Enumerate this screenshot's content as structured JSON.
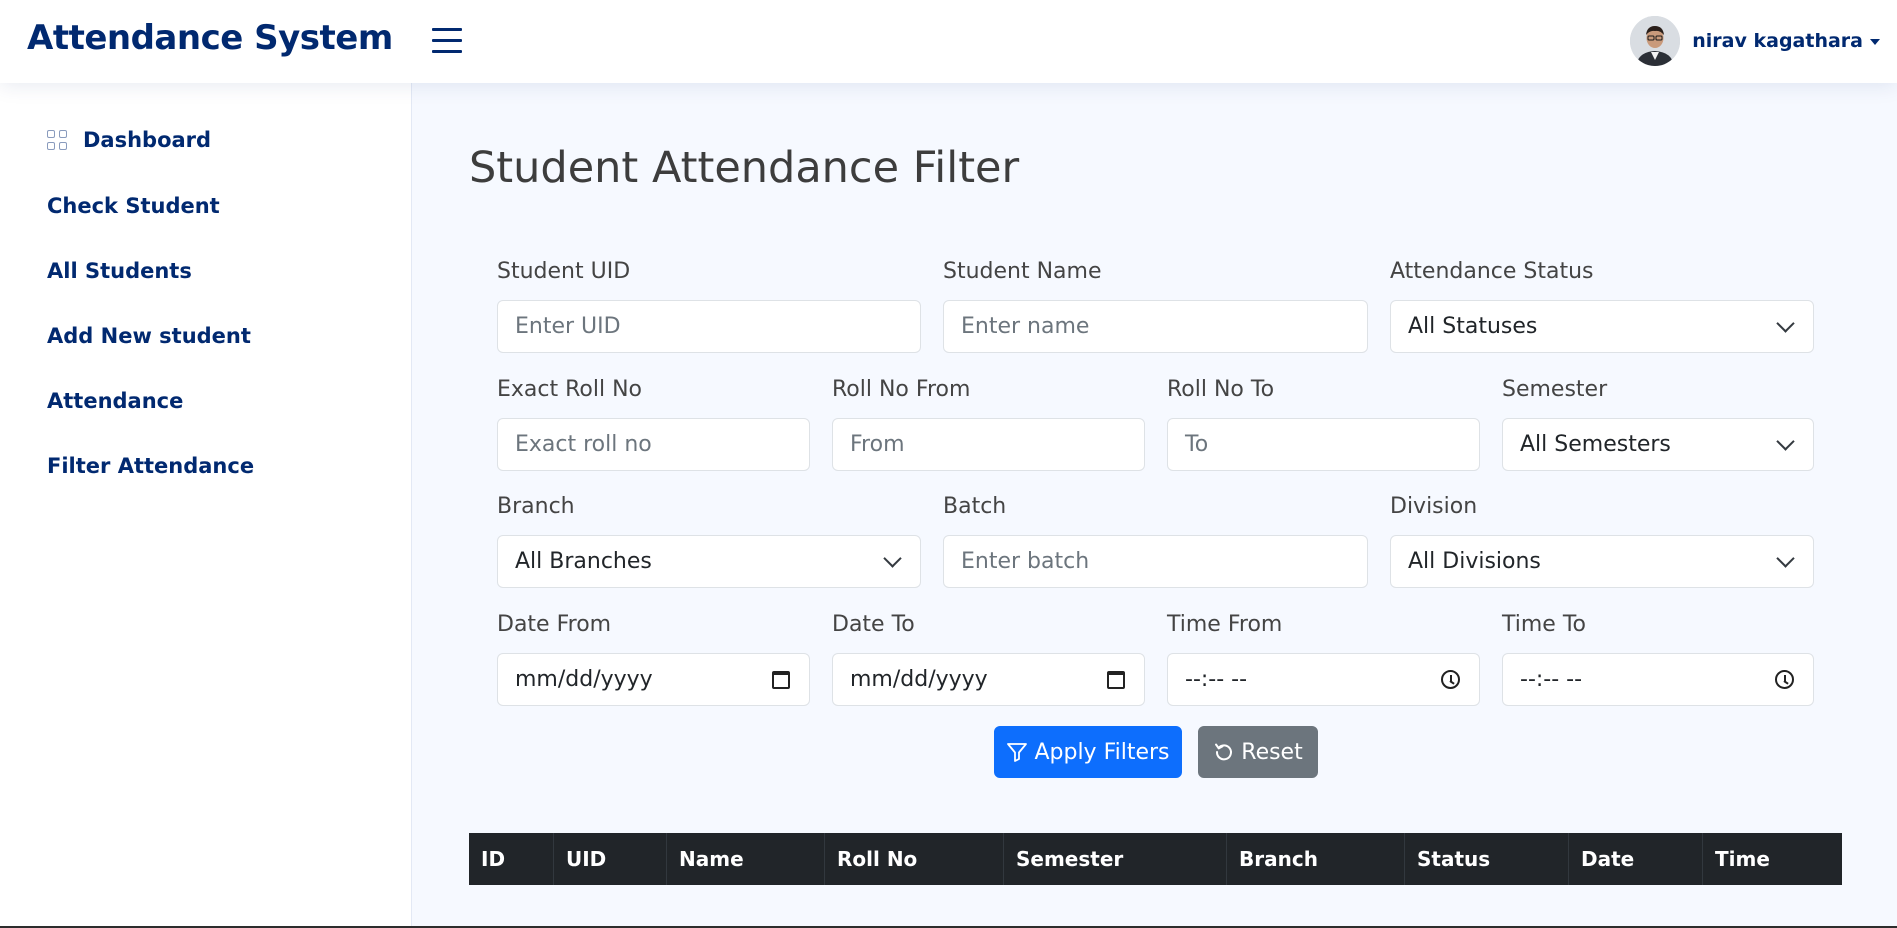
{
  "header": {
    "brand": "Attendance System",
    "user_name": "nirav kagathara"
  },
  "sidebar": {
    "items": [
      {
        "label": "Dashboard"
      },
      {
        "label": "Check Student"
      },
      {
        "label": "All Students"
      },
      {
        "label": "Add New student"
      },
      {
        "label": "Attendance"
      },
      {
        "label": "Filter Attendance"
      }
    ]
  },
  "page": {
    "title": "Student Attendance Filter"
  },
  "filters": {
    "uid": {
      "label": "Student UID",
      "placeholder": "Enter UID"
    },
    "name": {
      "label": "Student Name",
      "placeholder": "Enter name"
    },
    "status": {
      "label": "Attendance Status",
      "value": "All Statuses"
    },
    "exact_roll": {
      "label": "Exact Roll No",
      "placeholder": "Exact roll no"
    },
    "roll_from": {
      "label": "Roll No From",
      "placeholder": "From"
    },
    "roll_to": {
      "label": "Roll No To",
      "placeholder": "To"
    },
    "semester": {
      "label": "Semester",
      "value": "All Semesters"
    },
    "branch": {
      "label": "Branch",
      "value": "All Branches"
    },
    "batch": {
      "label": "Batch",
      "placeholder": "Enter batch"
    },
    "division": {
      "label": "Division",
      "value": "All Divisions"
    },
    "date_from": {
      "label": "Date From",
      "value": "mm/dd/yyyy"
    },
    "date_to": {
      "label": "Date To",
      "value": "mm/dd/yyyy"
    },
    "time_from": {
      "label": "Time From",
      "value": "--:-- --"
    },
    "time_to": {
      "label": "Time To",
      "value": "--:-- --"
    }
  },
  "actions": {
    "apply_label": "Apply Filters",
    "reset_label": "Reset"
  },
  "table": {
    "columns": [
      "ID",
      "UID",
      "Name",
      "Roll No",
      "Semester",
      "Branch",
      "Status",
      "Date",
      "Time"
    ]
  },
  "colors": {
    "brand": "#012970",
    "primary": "#0d6efd",
    "secondary": "#6c757d",
    "table_header": "#212529"
  }
}
